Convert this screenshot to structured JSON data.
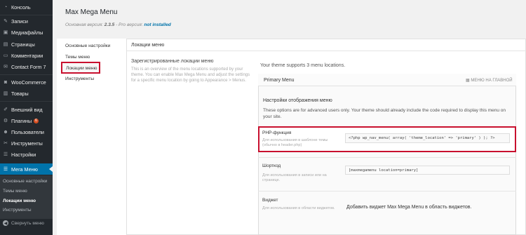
{
  "sidebar": {
    "items": [
      {
        "label": "Консоль",
        "icon": "dashboard-icon"
      },
      {
        "label": "Записи",
        "icon": "pin-icon"
      },
      {
        "label": "Медиафайлы",
        "icon": "media-icon"
      },
      {
        "label": "Страницы",
        "icon": "page-icon"
      },
      {
        "label": "Комментарии",
        "icon": "comment-icon"
      },
      {
        "label": "Contact Form 7",
        "icon": "mail-icon"
      },
      {
        "label": "WooCommerce",
        "icon": "woo-icon"
      },
      {
        "label": "Товары",
        "icon": "products-icon"
      },
      {
        "label": "Внешний вид",
        "icon": "brush-icon"
      },
      {
        "label": "Плагины",
        "icon": "plugin-icon",
        "badge": "6"
      },
      {
        "label": "Пользователи",
        "icon": "users-icon"
      },
      {
        "label": "Инструменты",
        "icon": "tools-icon"
      },
      {
        "label": "Настройки",
        "icon": "settings-icon"
      },
      {
        "label": "Мега Меню",
        "icon": "megamenu-icon",
        "current": true
      }
    ],
    "submenu": [
      {
        "label": "Основные настройки"
      },
      {
        "label": "Темы меню"
      },
      {
        "label": "Локации меню",
        "active": true
      },
      {
        "label": "Инструменты"
      }
    ],
    "collapse_label": "Свернуть меню"
  },
  "header": {
    "title": "Max Mega Menu",
    "version_prefix": "Основная версия:",
    "version": "2.3.5",
    "pro_prefix": "- Pro версия:",
    "pro_status": "not installed"
  },
  "nav": {
    "items": [
      "Основные настройки",
      "Темы меню",
      "Локации меню",
      "Инструменты"
    ]
  },
  "main": {
    "section_title": "Локации меню",
    "registered_label": "Зарегистрированные локации меню",
    "registered_desc": "This is an overview of the menu locations supported by your theme. You can enable Max Mega Menu and adjust the settings for a specific menu location by going to Appearance > Menus.",
    "supports_text": "Your theme supports 3 menu locations.",
    "location": {
      "title": "Primary Menu",
      "tag": "МЕНЮ НА ГЛАВНОЙ",
      "display_title": "Настройки отображения меню",
      "display_desc": "These options are for advanced users only. Your theme should already include the code required to display this menu on your site.",
      "php_label": "PHP-функция",
      "php_desc": "Для использования в шаблоне темы (обычно в header.php)",
      "php_code": "<?php wp_nav_menu( array( 'theme_location' => 'primary' ) ); ?>",
      "shortcode_label": "Шорткод",
      "shortcode_desc": "Для использования в записи или на странице.",
      "shortcode_code": "[maxmegamenu location=primary]",
      "widget_label": "Виджет",
      "widget_desc": "Для использования в области виджетов.",
      "widget_text": "Добавить виджет Max Mega Menu в область виджетов."
    }
  },
  "colors": {
    "sidebar_bg": "#23282d",
    "current": "#0073aa",
    "highlight": "#c8102e"
  }
}
